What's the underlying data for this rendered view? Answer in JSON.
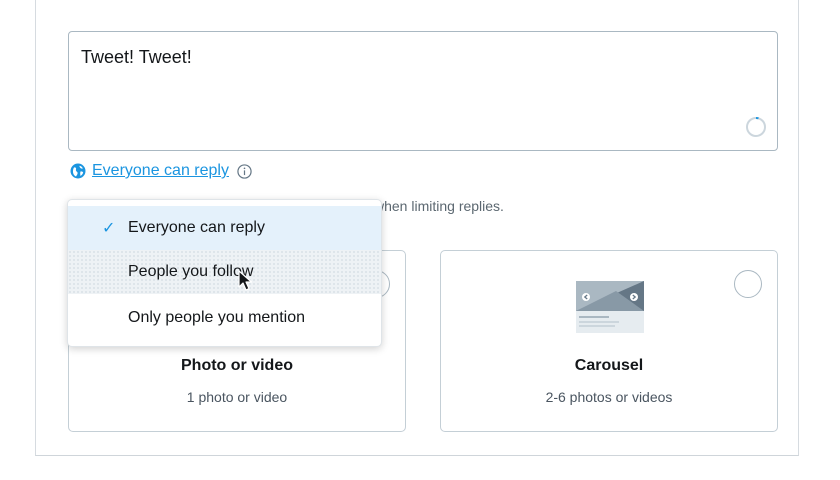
{
  "composer": {
    "text": "Tweet! Tweet!"
  },
  "reply_settings": {
    "link_label": "Everyone can reply",
    "helper_text_visible": "when limiting replies.",
    "link_color": "#1b95e0"
  },
  "dropdown": {
    "items": [
      {
        "label": "Everyone can reply",
        "selected": true,
        "check": "✓"
      },
      {
        "label": "People you follow",
        "selected": false,
        "hovered": true
      },
      {
        "label": "Only people you mention",
        "selected": false
      }
    ]
  },
  "cards": [
    {
      "title": "Photo or video",
      "subtitle": "1 photo or video"
    },
    {
      "title": "Carousel",
      "subtitle": "2-6 photos or videos"
    }
  ],
  "icons": {
    "globe": "globe-icon",
    "info": "info-icon",
    "check": "checkmark-icon",
    "counter": "character-counter-icon",
    "cursor": "mouse-pointer-icon",
    "carousel": "carousel-illustration-icon"
  }
}
